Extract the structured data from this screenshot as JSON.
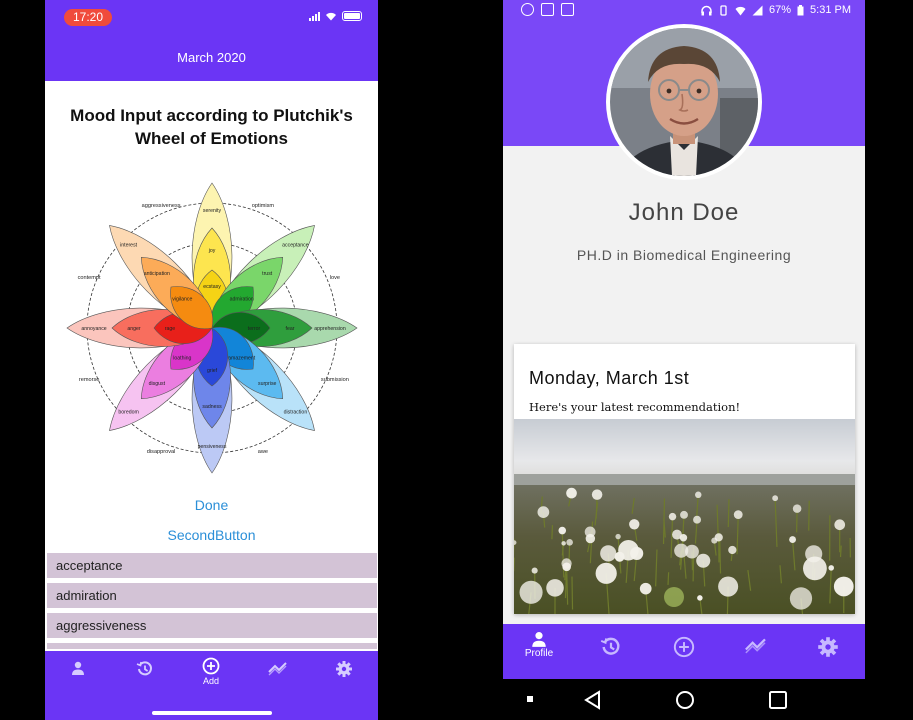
{
  "left_phone": {
    "status": {
      "time": "17:20"
    },
    "header_title": "March 2020",
    "mood_title": "Mood Input according to Plutchik's Wheel of Emotions",
    "wheel": {
      "outer_labels": [
        "optimism",
        "love",
        "submission",
        "awe",
        "disapproval",
        "remorse",
        "contempt",
        "aggressiveness"
      ],
      "petals": [
        {
          "name": "joy",
          "labels": [
            "serenity",
            "joy",
            "ecstasy"
          ],
          "colors": [
            "#fdf4b0",
            "#fde54f",
            "#f5d315"
          ]
        },
        {
          "name": "trust",
          "labels": [
            "acceptance",
            "trust",
            "admiration"
          ],
          "colors": [
            "#c8f0b8",
            "#7ad66a",
            "#23a830"
          ]
        },
        {
          "name": "fear",
          "labels": [
            "apprehension",
            "fear",
            "terror"
          ],
          "colors": [
            "#a9d9ad",
            "#2f9e3d",
            "#0b6e1c"
          ]
        },
        {
          "name": "surprise",
          "labels": [
            "distraction",
            "surprise",
            "amazement"
          ],
          "colors": [
            "#b9e2f9",
            "#5cbaf0",
            "#1285d8"
          ]
        },
        {
          "name": "sadness",
          "labels": [
            "pensiveness",
            "sadness",
            "grief"
          ],
          "colors": [
            "#bcc9f5",
            "#6e86ea",
            "#2a48d9"
          ]
        },
        {
          "name": "disgust",
          "labels": [
            "boredom",
            "disgust",
            "loathing"
          ],
          "colors": [
            "#f6c3f1",
            "#eb7ee0",
            "#d935c9"
          ]
        },
        {
          "name": "anger",
          "labels": [
            "annoyance",
            "anger",
            "rage"
          ],
          "colors": [
            "#fbc5bd",
            "#f86e5e",
            "#e8201a"
          ]
        },
        {
          "name": "anticipation",
          "labels": [
            "interest",
            "anticipation",
            "vigilance"
          ],
          "colors": [
            "#fdd9b3",
            "#fcab58",
            "#f58b10"
          ]
        }
      ]
    },
    "buttons": {
      "done": "Done",
      "second": "SecondButton"
    },
    "emotions": [
      "acceptance",
      "admiration",
      "aggressiveness"
    ],
    "tabs": [
      {
        "icon": "person-icon",
        "label": ""
      },
      {
        "icon": "history-icon",
        "label": ""
      },
      {
        "icon": "add-circle-icon",
        "label": "Add"
      },
      {
        "icon": "trend-icon",
        "label": ""
      },
      {
        "icon": "gear-icon",
        "label": ""
      }
    ]
  },
  "right_phone": {
    "status": {
      "battery": "67%",
      "time": "5:31 PM"
    },
    "profile": {
      "name": "John Doe",
      "degree": "PH.D in Biomedical Engineering"
    },
    "card": {
      "date": "Monday, March 1st",
      "subtitle": "Here's your latest recommendation!"
    },
    "tabs": [
      {
        "icon": "person-icon",
        "label": "Profile"
      },
      {
        "icon": "history-icon",
        "label": ""
      },
      {
        "icon": "add-circle-icon",
        "label": ""
      },
      {
        "icon": "trend-icon",
        "label": ""
      },
      {
        "icon": "gear-icon",
        "label": ""
      }
    ]
  },
  "colors": {
    "accent_purple": "#6b35f5",
    "link_blue": "#2b8fd8",
    "list_item_bg": "#d3c3d6"
  }
}
